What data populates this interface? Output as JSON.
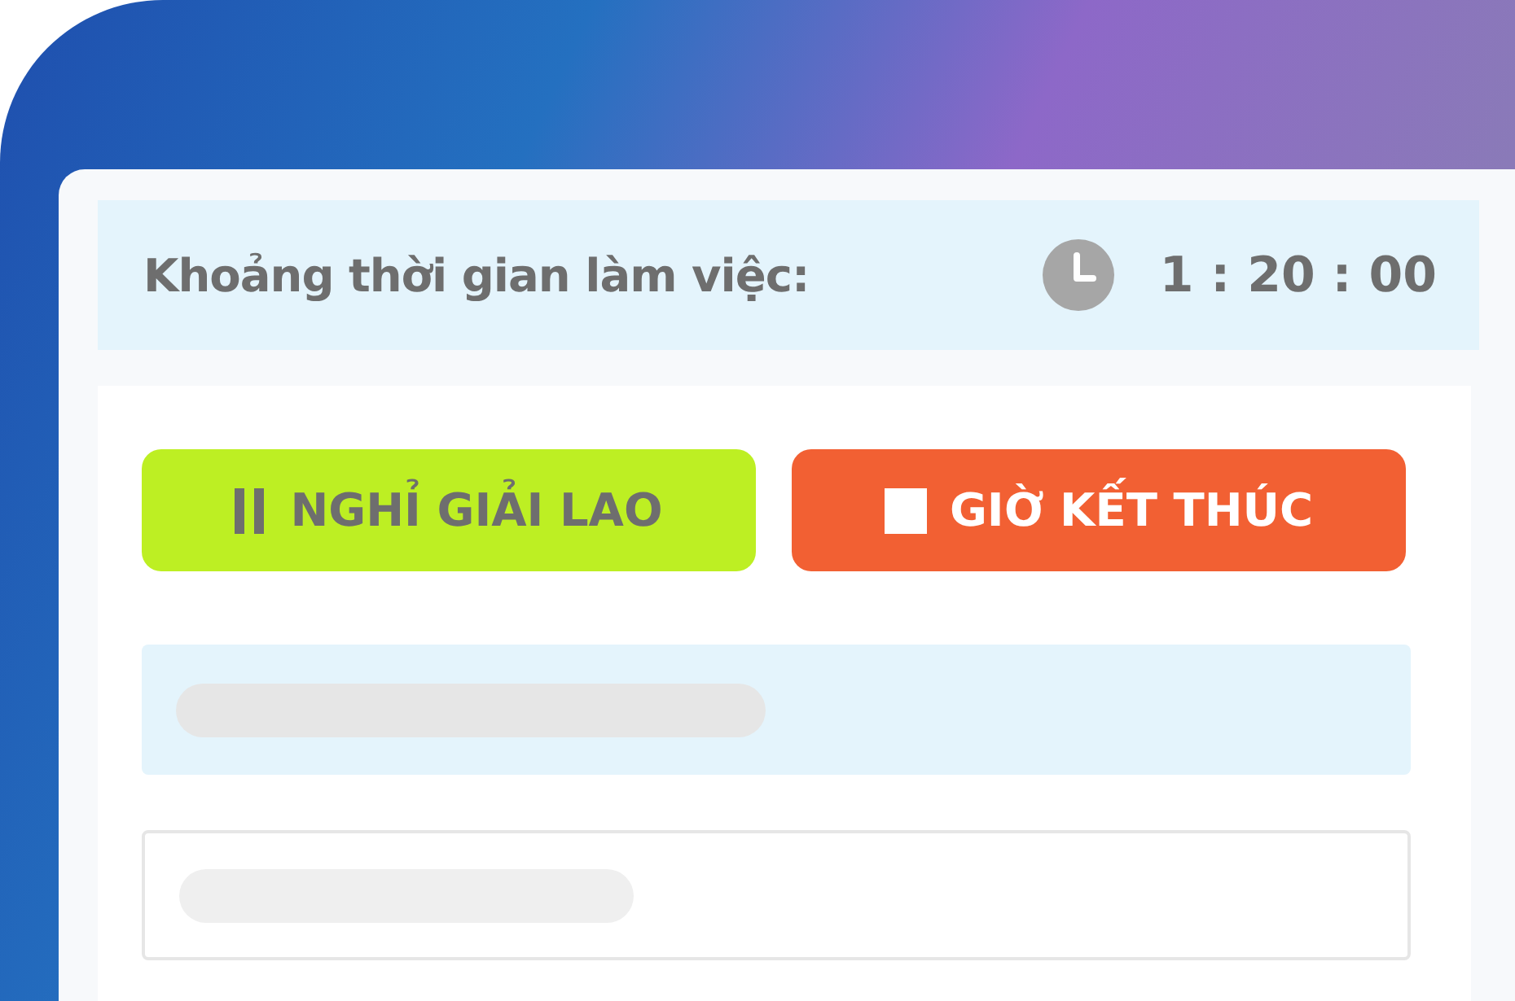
{
  "work_timer": {
    "label": "Khoảng thời gian làm việc:",
    "time": "1 : 20 : 00"
  },
  "buttons": [
    {
      "kind": "pause",
      "label": "NGHỈ GIẢI LAO"
    },
    {
      "kind": "stop",
      "label": "GIỜ KẾT THÚC"
    }
  ]
}
